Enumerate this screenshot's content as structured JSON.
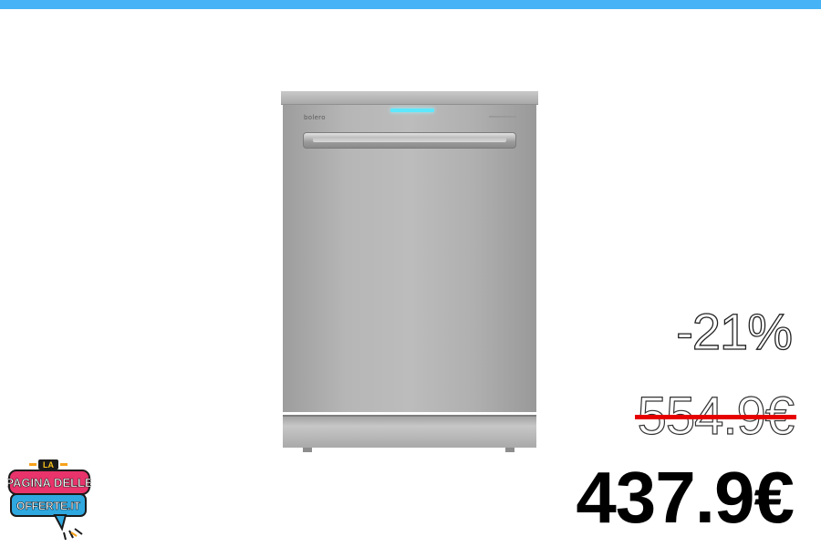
{
  "colors": {
    "top_bar": "#45b3f5",
    "strike": "#e60000",
    "new_price": "#000000"
  },
  "product": {
    "brand": "bolero",
    "image": "stainless dishwasher"
  },
  "price": {
    "discount": "-21%",
    "old": "554.9€",
    "new": "437.9€"
  },
  "logo": {
    "line1": "LA",
    "line2": "PAGINA DELLE",
    "line3": "OFFERTE.IT"
  }
}
